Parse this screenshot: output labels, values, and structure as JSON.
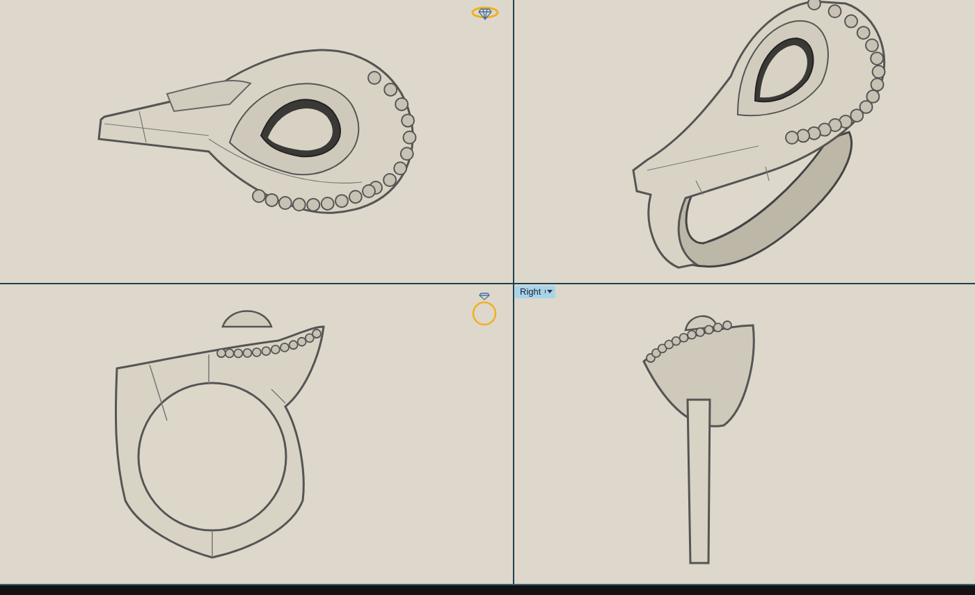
{
  "viewports": [
    {
      "kind": "top"
    },
    {
      "kind": "perspective"
    },
    {
      "kind": "front"
    },
    {
      "kind": "right",
      "label": "Right"
    }
  ]
}
